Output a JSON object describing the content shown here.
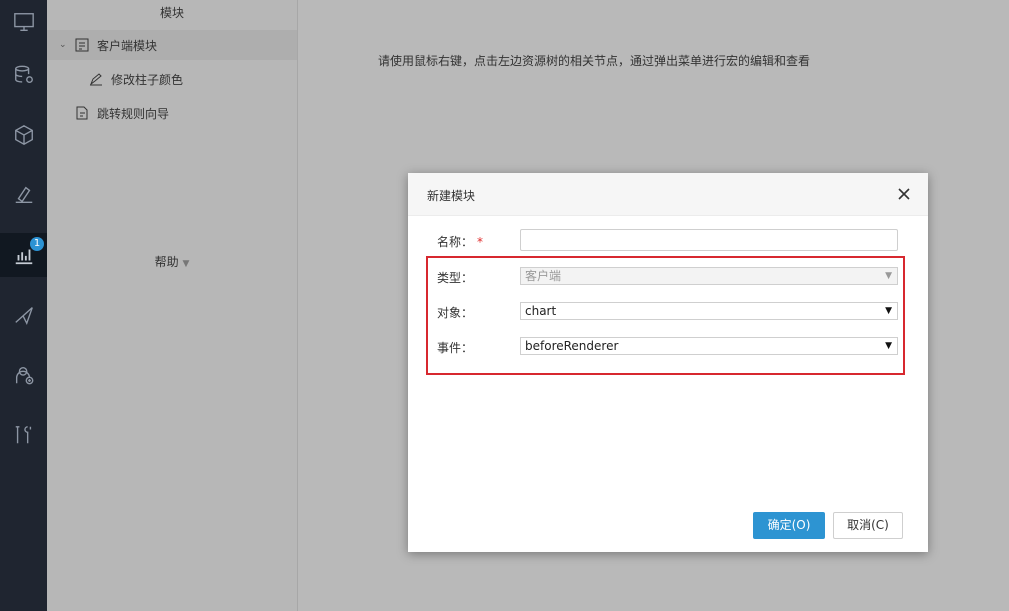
{
  "rail": {
    "items": [
      {
        "icon": "monitor-icon"
      },
      {
        "icon": "database-gear-icon"
      },
      {
        "icon": "cube-icon"
      },
      {
        "icon": "pen-design-icon"
      },
      {
        "icon": "chart-icon",
        "badge": "1"
      },
      {
        "icon": "send-icon"
      },
      {
        "icon": "user-add-icon"
      },
      {
        "icon": "tools-icon"
      }
    ]
  },
  "tree": {
    "title": "模块",
    "client_module": "客户端模块",
    "modify_color": "修改柱子颜色",
    "jump_wizard": "跳转规则向导",
    "help": "帮助"
  },
  "main": {
    "hint": "请使用鼠标右键，点击左边资源树的相关节点，通过弹出菜单进行宏的编辑和查看"
  },
  "dialog": {
    "title": "新建模块",
    "name_label": "名称：",
    "required_mark": "*",
    "name_value": "",
    "type_label": "类型：",
    "type_value": "客户端",
    "object_label": "对象：",
    "object_value": "chart",
    "event_label": "事件：",
    "event_value": "beforeRenderer",
    "ok_label": "确定(O)",
    "cancel_label": "取消(C)"
  },
  "colors": {
    "accent": "#2d94d2",
    "highlight": "#d7282f"
  }
}
